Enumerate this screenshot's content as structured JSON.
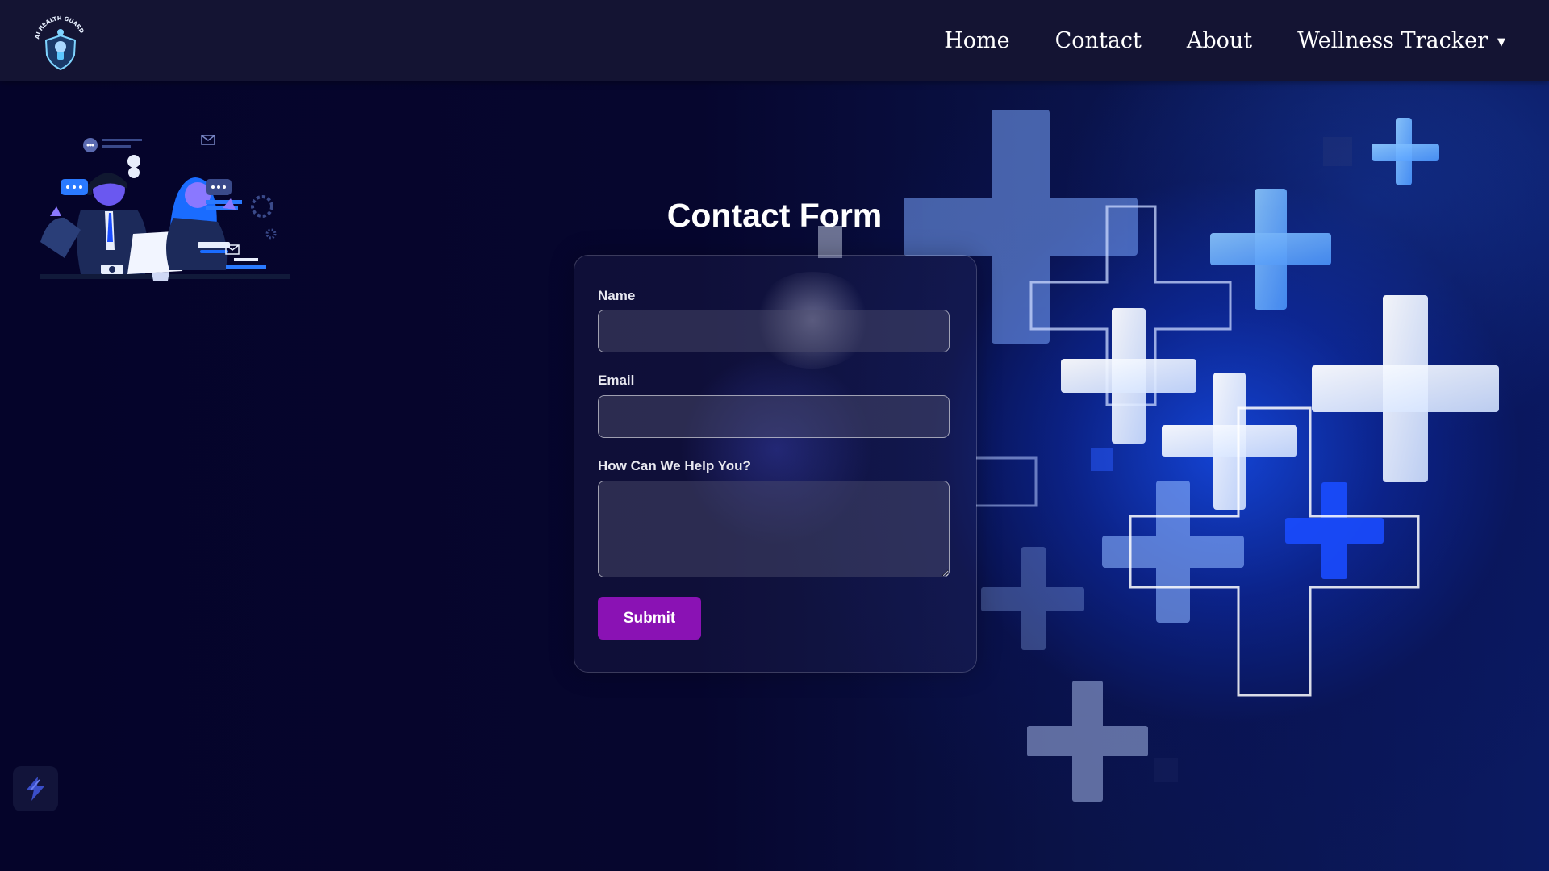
{
  "brand": {
    "logo_text": "AI HEALTH GUARD",
    "logo_icon": "shield-logo-icon"
  },
  "nav": {
    "items": [
      {
        "label": "Home"
      },
      {
        "label": "Contact"
      },
      {
        "label": "About"
      },
      {
        "label": "Wellness Tracker",
        "icon": "caret-down-icon"
      }
    ]
  },
  "form": {
    "title": "Contact Form",
    "fields": {
      "name": {
        "label": "Name",
        "value": "",
        "placeholder": ""
      },
      "email": {
        "label": "Email",
        "value": "",
        "placeholder": ""
      },
      "message": {
        "label": "How Can We Help You?",
        "value": "",
        "placeholder": ""
      }
    },
    "submit_label": "Submit"
  },
  "widgets": {
    "corner_icon": "lightning-widget-icon"
  },
  "colors": {
    "background": "#05052a",
    "navbar": "#141433",
    "accent_button": "#8a12b4",
    "glow_blue": "#1446dc"
  }
}
